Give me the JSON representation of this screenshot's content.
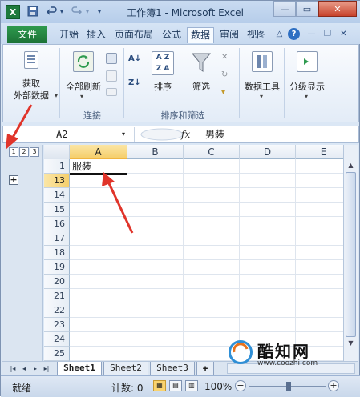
{
  "app": {
    "title": "工作簿1 - Microsoft Excel",
    "logo_letter": "X"
  },
  "window_controls": {
    "minimize": "—",
    "maximize": "▭",
    "close": "✕"
  },
  "quick_access": {
    "save_icon": "save-icon",
    "undo_icon": "undo-icon",
    "redo_icon": "redo-icon",
    "customize": "▾"
  },
  "ribbon_tabs": [
    "文件",
    "开始",
    "插入",
    "页面布局",
    "公式",
    "数据",
    "审阅",
    "视图"
  ],
  "ribbon_active_tab": "数据",
  "ribbon": {
    "get_external_data": {
      "line1": "获取",
      "line2": "外部数据"
    },
    "refresh_all": "全部刷新",
    "connections_group": "连接",
    "sort": "排序",
    "filter": "筛选",
    "sort_filter_group": "排序和筛选",
    "data_tools": "数据工具",
    "outline": "分级显示"
  },
  "formula_bar": {
    "name_box": "A2",
    "fx": "fx",
    "content": "男装"
  },
  "outline_levels": [
    "1",
    "2",
    "3"
  ],
  "outline_expand": "+",
  "columns": [
    "A",
    "B",
    "C",
    "D",
    "E"
  ],
  "rows": [
    "1",
    "13",
    "14",
    "15",
    "16",
    "17",
    "18",
    "19",
    "20",
    "21",
    "22",
    "23",
    "24",
    "25"
  ],
  "cells": {
    "A1": "服装"
  },
  "sheet_nav": [
    "|◂",
    "◂",
    "▸",
    "▸|"
  ],
  "sheets": [
    "Sheet1",
    "Sheet2",
    "Sheet3"
  ],
  "active_sheet": "Sheet1",
  "status": {
    "ready": "就绪",
    "count": "计数: 0",
    "zoom": "100%",
    "zoom_minus": "−",
    "zoom_plus": "+"
  },
  "watermark": {
    "brand": "酷知网",
    "url": "www.coozhi.com"
  },
  "colors": {
    "file_tab": "#1c7236",
    "selected_header": "#f5cf6c",
    "annotation_arrow": "#e0342a"
  }
}
